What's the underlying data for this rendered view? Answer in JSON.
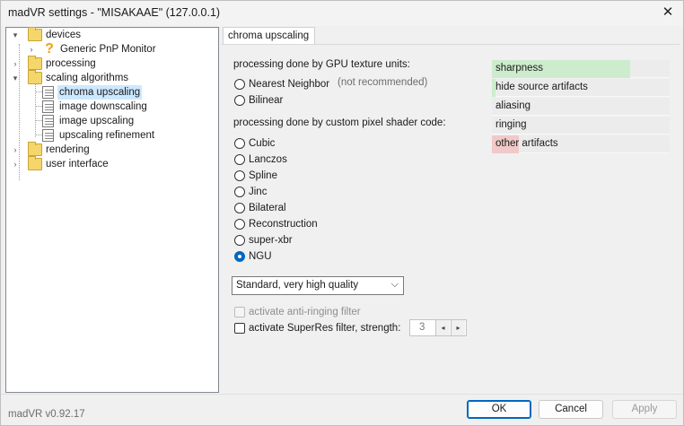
{
  "window": {
    "title": "madVR settings - \"MISAKAAE\" (127.0.0.1)",
    "close_glyph": "✕",
    "version": "madVR v0.92.17"
  },
  "tree": {
    "items": [
      {
        "label": "devices",
        "icon": "folder-icon",
        "expander": "down"
      },
      {
        "label": "Generic PnP Monitor",
        "icon": "question-mark-icon",
        "expander": "right"
      },
      {
        "label": "processing",
        "icon": "folder-icon",
        "expander": "right"
      },
      {
        "label": "scaling algorithms",
        "icon": "folder-icon",
        "expander": "down"
      },
      {
        "label": "chroma upscaling",
        "icon": "document-icon",
        "selected": true
      },
      {
        "label": "image downscaling",
        "icon": "document-icon"
      },
      {
        "label": "image upscaling",
        "icon": "document-icon"
      },
      {
        "label": "upscaling refinement",
        "icon": "document-icon"
      },
      {
        "label": "rendering",
        "icon": "folder-icon",
        "expander": "right"
      },
      {
        "label": "user interface",
        "icon": "folder-icon",
        "expander": "right"
      }
    ]
  },
  "tab": {
    "label": "chroma upscaling"
  },
  "gpu_section": {
    "heading": "processing done by GPU texture units:",
    "options": [
      "Nearest Neighbor",
      "Bilinear"
    ],
    "nearest_note": "(not recommended)"
  },
  "shader_section": {
    "heading": "processing done by custom pixel shader code:",
    "options": [
      "Cubic",
      "Lanczos",
      "Spline",
      "Jinc",
      "Bilateral",
      "Reconstruction",
      "super-xbr",
      "NGU"
    ],
    "selected": "NGU"
  },
  "quality_select": {
    "value": "Standard, very high quality",
    "arrow": "⌵"
  },
  "checks": {
    "anti_ringing": "activate anti-ringing filter",
    "superres": "activate SuperRes filter, strength:",
    "strength_value": "3",
    "spin_left": "◂",
    "spin_right": "▸"
  },
  "meters": [
    {
      "label": "sharpness",
      "level": 0.78,
      "color": "#cdeccd"
    },
    {
      "label": "hide source artifacts",
      "level": 0.02,
      "color": "#cdeccd"
    },
    {
      "label": "aliasing",
      "level": 0,
      "color": "#cdeccd"
    },
    {
      "label": "ringing",
      "level": 0,
      "color": "#cdeccd"
    },
    {
      "label": "other artifacts",
      "level": 0.15,
      "color": "#f1c9c9"
    }
  ],
  "buttons": {
    "ok": "OK",
    "cancel": "Cancel",
    "apply": "Apply"
  }
}
